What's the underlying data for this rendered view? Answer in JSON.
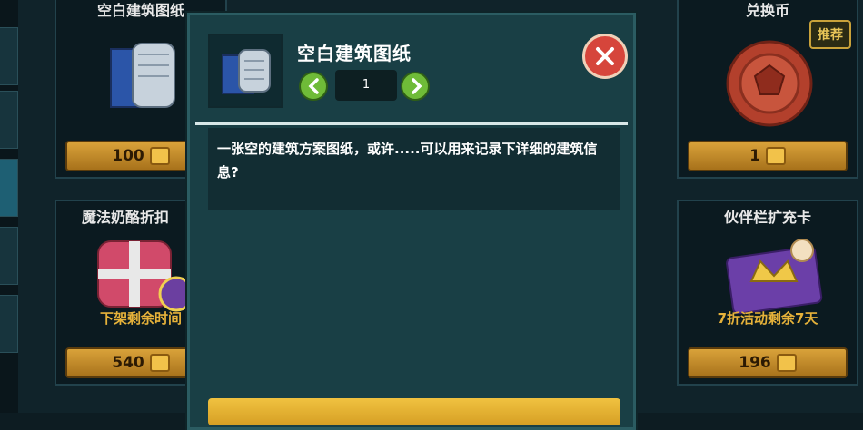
{
  "shop": {
    "items": [
      {
        "name": "空白建筑图纸",
        "price": "100",
        "note": "",
        "badge": ""
      },
      {
        "name": "兑换币",
        "price": "1",
        "note": "",
        "badge": "推荐"
      },
      {
        "name": "魔法奶酪折扣",
        "price": "540",
        "note": "下架剩余时间",
        "badge": ""
      },
      {
        "name": "伙伴栏扩充卡",
        "price": "196",
        "note": "7折活动剩余7天",
        "badge": ""
      }
    ]
  },
  "dialog": {
    "title": "空白建筑图纸",
    "quantity": "1",
    "description": "一张空的建筑方案图纸，或许.....可以用来记录下详细的建筑信息?"
  },
  "icons": {
    "close": "close-icon",
    "prev": "chevron-left-icon",
    "next": "chevron-right-icon",
    "currency": "coin-icon",
    "item": "blueprint-icon"
  },
  "colors": {
    "dialog_bg": "#193f45",
    "price_gold": "#d9a23a",
    "arrow_green": "#6fbb38",
    "close_red": "#d6453b",
    "note_orange": "#e6b23a"
  }
}
